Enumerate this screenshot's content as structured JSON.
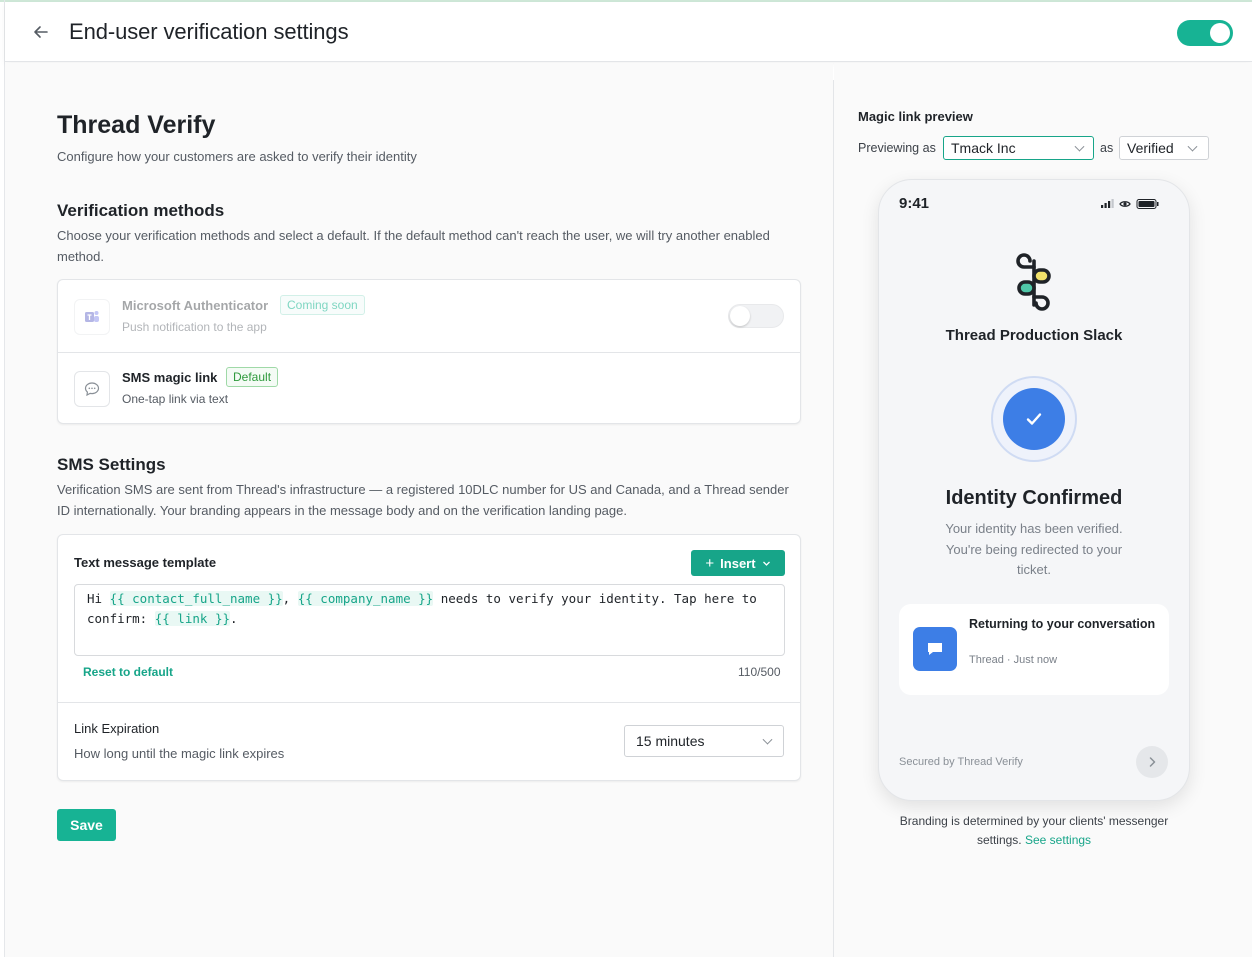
{
  "header": {
    "title": "End-user verification settings",
    "enabled": true
  },
  "main": {
    "title": "Thread Verify",
    "subtitle": "Configure how your customers are asked to verify their identity",
    "verification": {
      "heading": "Verification methods",
      "description": "Choose your verification methods and select a default. If the default method can't reach the user, we will try another enabled method.",
      "methods": [
        {
          "title": "Microsoft Authenticator",
          "badge": "Coming soon",
          "subtitle": "Push notification to the app",
          "icon": "microsoft-teams-icon",
          "enabled": false,
          "disabled": true
        },
        {
          "title": "SMS magic link",
          "badge": "Default",
          "subtitle": "One-tap link via text",
          "icon": "chat-bubble-icon"
        }
      ]
    },
    "sms": {
      "heading": "SMS Settings",
      "description": "Verification SMS are sent from Thread's infrastructure — a registered 10DLC number for US and Canada, and a Thread sender ID internationally. Your branding appears in the message body and on the verification landing page.",
      "template_label": "Text message template",
      "insert_label": "Insert",
      "template": {
        "t1": "Hi ",
        "v1": "{{ contact_full_name }}",
        "t2": ", ",
        "v2": "{{ company_name }}",
        "t3": " needs to verify your identity. Tap here to confirm: ",
        "v3": "{{ link }}",
        "t4": "."
      },
      "reset_label": "Reset to default",
      "char_count": "110/500",
      "expiration_title": "Link Expiration",
      "expiration_desc": "How long until the magic link expires",
      "expiration_value": "15 minutes"
    },
    "save_label": "Save"
  },
  "preview": {
    "title": "Magic link preview",
    "previewing_as": "Previewing as",
    "client": "Tmack Inc",
    "as_word": "as",
    "state": "Verified",
    "phone": {
      "time": "9:41",
      "brand": "Thread Production Slack",
      "heading": "Identity Confirmed",
      "message": "Your identity has been verified. You're being redirected to your ticket.",
      "card_title": "Returning to your conversation",
      "card_sub": "Thread · Just now",
      "secured": "Secured by Thread Verify"
    },
    "footnote": "Branding is determined by your clients' messenger settings.",
    "footnote_link": "See settings"
  },
  "colors": {
    "accent": "#17b394",
    "accent_dark": "#17a589",
    "phone_blue": "#3d7ee6"
  }
}
